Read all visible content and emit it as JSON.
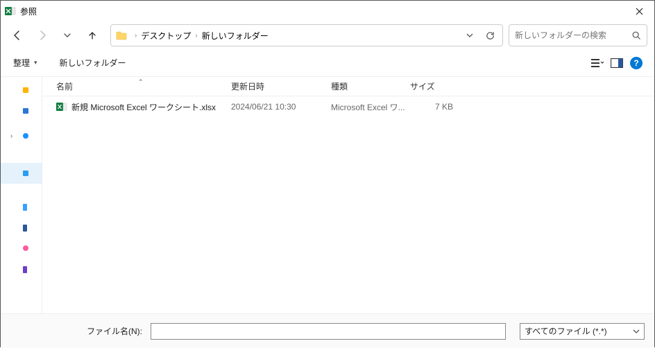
{
  "title": "参照",
  "breadcrumb": {
    "segments": [
      "デスクトップ",
      "新しいフォルダー"
    ]
  },
  "search": {
    "placeholder": "新しいフォルダーの検索"
  },
  "toolbar": {
    "organize": "整理",
    "new_folder": "新しいフォルダー"
  },
  "columns": {
    "name": "名前",
    "date": "更新日時",
    "type": "種類",
    "size": "サイズ"
  },
  "files": [
    {
      "name": "新規 Microsoft Excel ワークシート.xlsx",
      "date": "2024/06/21 10:30",
      "type": "Microsoft Excel ワ...",
      "size": "7 KB"
    }
  ],
  "bottom": {
    "filename_label": "ファイル名(N):",
    "filename_value": "",
    "filter_label": "すべてのファイル (*.*)"
  },
  "help_glyph": "?"
}
